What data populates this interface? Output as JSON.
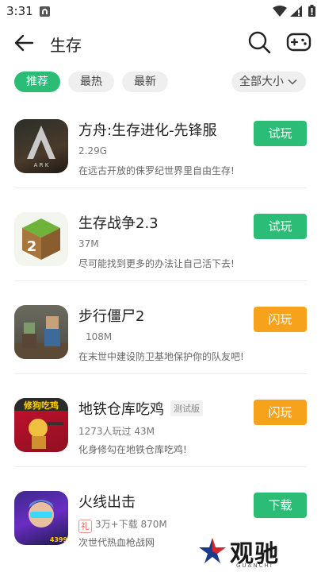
{
  "status_bar": {
    "time": "3:31"
  },
  "header": {
    "title": "生存"
  },
  "filters": {
    "tabs": [
      {
        "label": "推荐",
        "active": true
      },
      {
        "label": "最热",
        "active": false
      },
      {
        "label": "最新",
        "active": false
      }
    ],
    "size_select": "全部大小"
  },
  "colors": {
    "accent_green": "#2bbc76",
    "accent_orange": "#f7a21b"
  },
  "games": [
    {
      "name": "方舟:生存进化-先锋服",
      "meta": "2.29G",
      "desc": "在远古开放的侏罗纪世界里自由生存!",
      "button": "试玩",
      "button_color": "green",
      "icon": "ark-icon"
    },
    {
      "name": "生存战争2.3",
      "meta": "37M",
      "desc": "尽可能找到更多的办法让自己活下去!",
      "button": "试玩",
      "button_color": "green",
      "icon": "survivalcraft-icon"
    },
    {
      "name": "步行僵尸2",
      "meta": "108M",
      "desc": "在末世中建设防卫基地保护你的队友吧!",
      "button": "闪玩",
      "button_color": "orange",
      "icon": "walking-zombie-icon"
    },
    {
      "name": "地铁仓库吃鸡",
      "tag": "测试版",
      "meta": "1273人玩过   43M",
      "desc": "化身修勾在地铁仓库吃鸡!",
      "button": "闪玩",
      "button_color": "orange",
      "icon": "subway-chicken-icon",
      "icon_text": "修狗吃鸡"
    },
    {
      "name": "火线出击",
      "gift_tag": "礼",
      "meta": "3万+下载   870M",
      "desc": "次世代热血枪战网",
      "button": "下载",
      "button_color": "green",
      "icon": "fire-strike-icon",
      "icon_text": "4399"
    }
  ],
  "watermark": {
    "text": "观驰",
    "sub": "GUANCHI"
  }
}
